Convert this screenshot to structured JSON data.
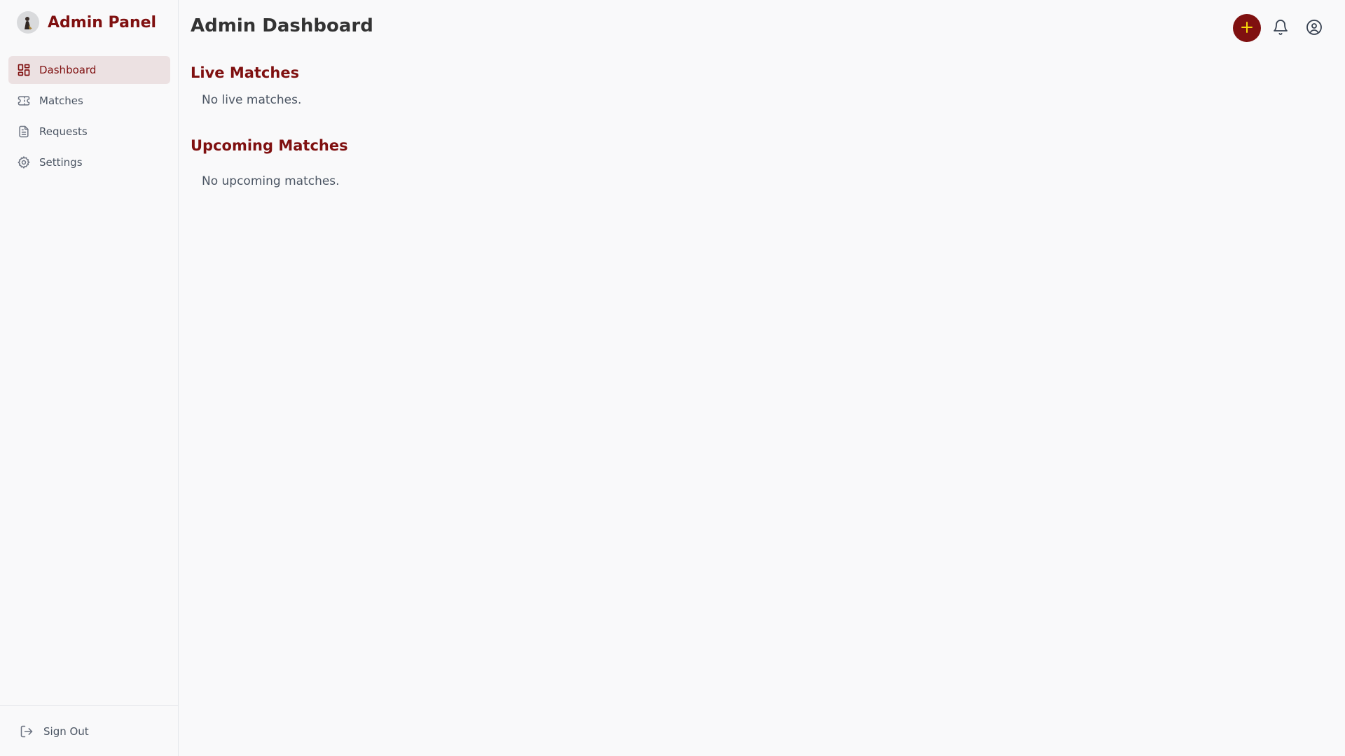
{
  "sidebar": {
    "brand": {
      "title": "Admin Panel",
      "logo_icon": "avatar-logo-icon"
    },
    "nav": [
      {
        "label": "Dashboard",
        "icon": "grid-icon",
        "active": true
      },
      {
        "label": "Matches",
        "icon": "ticket-icon",
        "active": false
      },
      {
        "label": "Requests",
        "icon": "document-icon",
        "active": false
      },
      {
        "label": "Settings",
        "icon": "gear-icon",
        "active": false
      }
    ],
    "signout": {
      "label": "Sign Out",
      "icon": "logout-icon"
    }
  },
  "header": {
    "title": "Admin Dashboard",
    "actions": {
      "add_icon": "plus-icon",
      "notifications_icon": "bell-icon",
      "profile_icon": "user-circle-icon"
    }
  },
  "sections": {
    "live": {
      "title": "Live Matches",
      "empty_text": "No live matches."
    },
    "upcoming": {
      "title": "Upcoming Matches",
      "empty_text": "No upcoming matches."
    }
  },
  "colors": {
    "accent": "#7f1010",
    "active_nav_bg": "#ece1e2",
    "fab_icon": "#f5d90a",
    "background": "#f9f9fa"
  }
}
